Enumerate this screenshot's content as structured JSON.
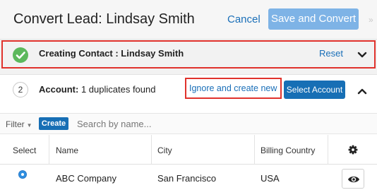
{
  "header": {
    "title": "Convert Lead: Lindsay Smith",
    "cancel_label": "Cancel",
    "save_label": "Save and Convert"
  },
  "step1": {
    "label": "Creating Contact : Lindsay Smith",
    "reset_label": "Reset",
    "status_icon": "check-icon"
  },
  "step2": {
    "number": "2",
    "label_bold": "Account:",
    "label_text": " 1 duplicates found",
    "ignore_label": "Ignore and create new",
    "select_label": "Select Account"
  },
  "filter": {
    "filter_label": "Filter",
    "create_label": "Create",
    "search_placeholder": "Search by name..."
  },
  "table": {
    "columns": [
      "Select",
      "Name",
      "City",
      "Billing Country"
    ],
    "rows": [
      {
        "selected": true,
        "name": "ABC Company",
        "city": "San Francisco",
        "country": "USA"
      }
    ]
  },
  "colors": {
    "link": "#1a6fb8",
    "primary_button": "#176fb5",
    "disabled_button": "#7eb3e6",
    "success": "#5cb85c",
    "highlight_outline": "#e0322c"
  }
}
